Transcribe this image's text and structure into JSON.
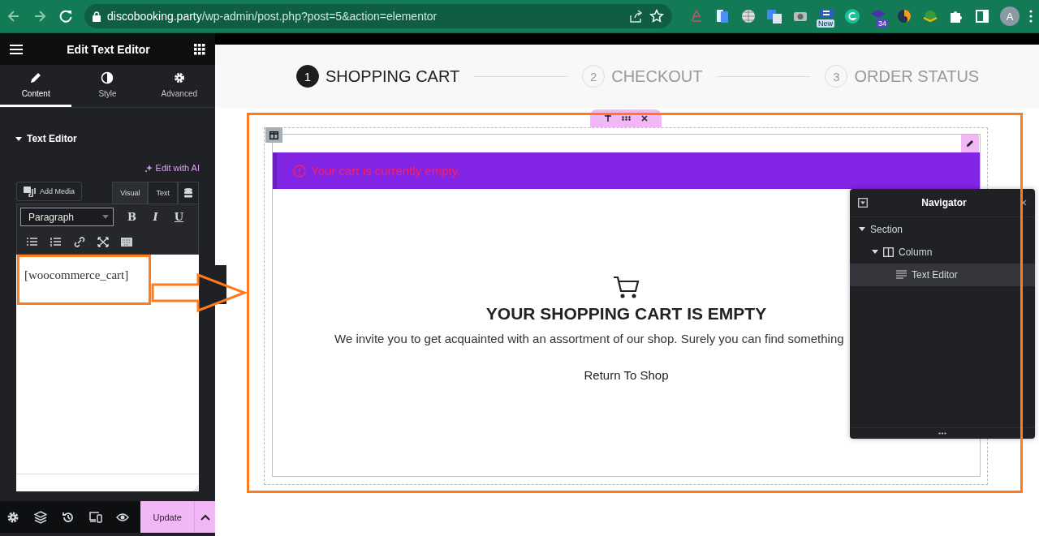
{
  "browser": {
    "url_host": "discobooking.party",
    "url_path": "/wp-admin/post.php?post=5&action=elementor",
    "extension_badges": [
      "New",
      "34"
    ],
    "profile_initial": "A"
  },
  "panel": {
    "title": "Edit Text Editor",
    "tabs": [
      {
        "label": "Content",
        "selected": true
      },
      {
        "label": "Style",
        "selected": false
      },
      {
        "label": "Advanced",
        "selected": false
      }
    ],
    "section": {
      "title": "Text Editor",
      "expanded": true
    },
    "edit_with_ai": "Edit with AI",
    "add_media": "Add Media",
    "editor_tabs": [
      {
        "label": "Visual",
        "selected": true
      },
      {
        "label": "Text",
        "selected": false
      }
    ],
    "format": "Paragraph",
    "format_buttons": [
      "B",
      "I",
      "U"
    ],
    "content": "[woocommerce_cart]",
    "update_button": "Update"
  },
  "steps": [
    {
      "number": "1",
      "label": "SHOPPING CART",
      "selected": true
    },
    {
      "number": "2",
      "label": "CHECKOUT",
      "selected": false
    },
    {
      "number": "3",
      "label": "ORDER STATUS",
      "selected": false
    }
  ],
  "cart": {
    "notice": "Your cart is currently empty.",
    "heading": "YOUR SHOPPING CART IS EMPTY",
    "text": "We invite you to get acquainted with an assortment of our shop. Surely you can find something",
    "return_link": "Return To Shop"
  },
  "navigator": {
    "title": "Navigator",
    "tree": [
      {
        "label": "Section",
        "expanded": true,
        "selected": false,
        "children": [
          {
            "label": "Column",
            "kind": "column",
            "expanded": true,
            "selected": false,
            "children": [
              {
                "label": "Text Editor",
                "kind": "text",
                "selected": true
              }
            ]
          }
        ]
      }
    ]
  }
}
